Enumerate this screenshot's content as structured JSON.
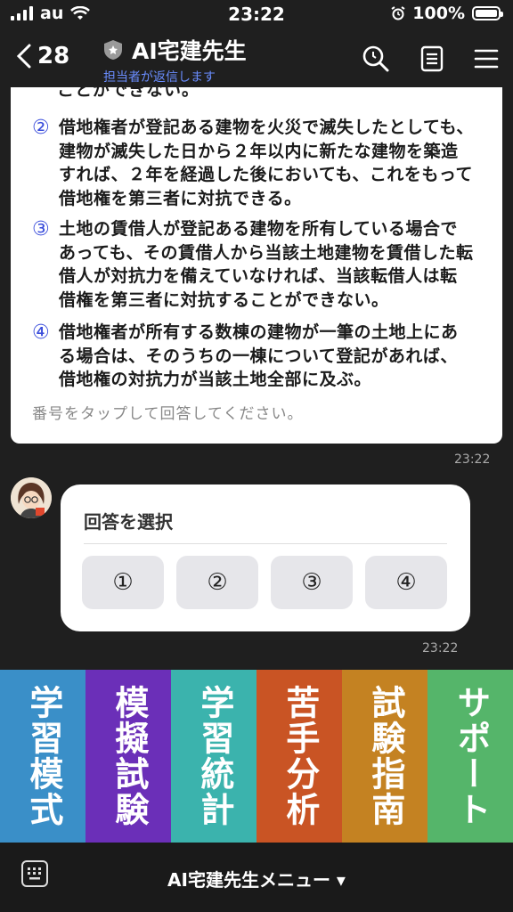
{
  "status": {
    "carrier": "au",
    "time": "23:22",
    "battery": "100%"
  },
  "header": {
    "back_count": "28",
    "title": "AI宅建先生",
    "subtitle": "担当者が返信します"
  },
  "question": {
    "cut_line": "ことができない。",
    "options": [
      {
        "num": "②",
        "text": "借地権者が登記ある建物を火災で滅失したとしても、建物が滅失した日から２年以内に新たな建物を築造すれば、２年を経過した後においても、これをもって借地権を第三者に対抗できる。"
      },
      {
        "num": "③",
        "text": "土地の賃借人が登記ある建物を所有している場合であっても、その賃借人から当該土地建物を賃借した転借人が対抗力を備えていなければ、当該転借人は転借権を第三者に対抗することができない。"
      },
      {
        "num": "④",
        "text": "借地権者が所有する数棟の建物が一筆の土地上にある場合は、そのうちの一棟について登記があれば、借地権の対抗力が当該土地全部に及ぶ。"
      }
    ],
    "hint": "番号をタップして回答してください。",
    "timestamp": "23:22"
  },
  "answer_card": {
    "title": "回答を選択",
    "buttons": [
      "①",
      "②",
      "③",
      "④"
    ],
    "timestamp": "23:22"
  },
  "rich_menu": [
    {
      "label": "学習模式",
      "color": "#3a8fc8"
    },
    {
      "label": "模擬試験",
      "color": "#6b2fb8"
    },
    {
      "label": "学習統計",
      "color": "#3bb3ad"
    },
    {
      "label": "苦手分析",
      "color": "#c95424"
    },
    {
      "label": "試験指南",
      "color": "#c48222"
    },
    {
      "label": "サポート",
      "color": "#55b56a"
    }
  ],
  "bottom_bar": {
    "menu_label": "AI宅建先生メニュー ▾"
  }
}
